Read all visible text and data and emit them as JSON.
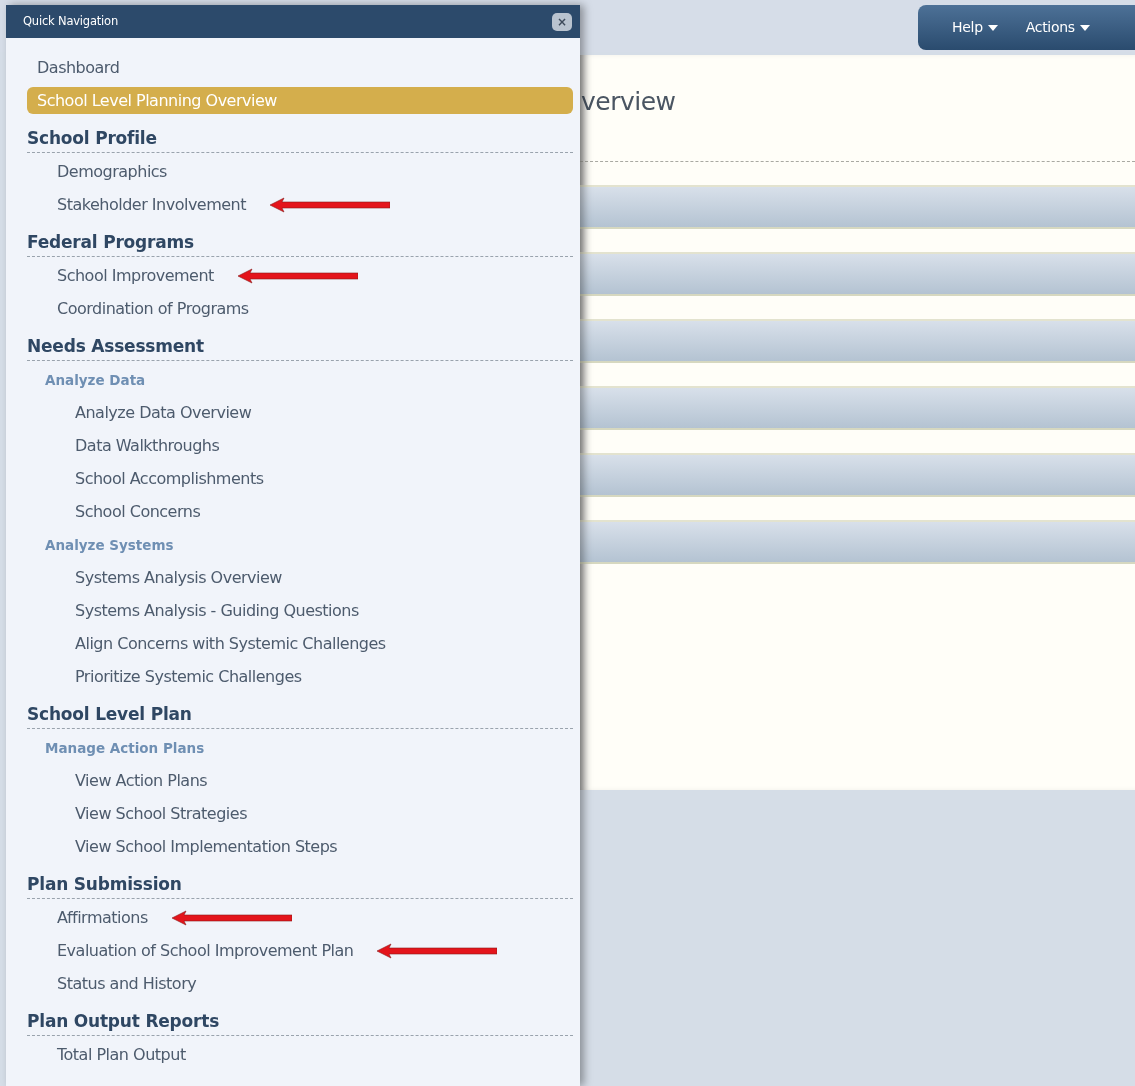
{
  "quick_navigation": {
    "title": "Quick Navigation",
    "close": "×",
    "items": [
      {
        "kind": "link",
        "label": "Dashboard",
        "selected": false,
        "arrow": false
      },
      {
        "kind": "link",
        "label": "School Level Planning Overview",
        "selected": true,
        "arrow": false
      },
      {
        "kind": "section",
        "label": "School Profile",
        "children": [
          {
            "kind": "link",
            "label": "Demographics",
            "selected": false,
            "arrow": false
          },
          {
            "kind": "link",
            "label": "Stakeholder Involvement",
            "selected": false,
            "arrow": true
          }
        ]
      },
      {
        "kind": "section",
        "label": "Federal Programs",
        "children": [
          {
            "kind": "link",
            "label": "School Improvement",
            "selected": false,
            "arrow": true
          },
          {
            "kind": "link",
            "label": "Coordination of Programs",
            "selected": false,
            "arrow": false
          }
        ]
      },
      {
        "kind": "section",
        "label": "Needs Assessment",
        "children": [
          {
            "kind": "group",
            "label": "Analyze Data",
            "children": [
              {
                "kind": "link",
                "label": "Analyze Data Overview",
                "selected": false,
                "arrow": false
              },
              {
                "kind": "link",
                "label": "Data Walkthroughs",
                "selected": false,
                "arrow": false
              },
              {
                "kind": "link",
                "label": "School Accomplishments",
                "selected": false,
                "arrow": false
              },
              {
                "kind": "link",
                "label": "School Concerns",
                "selected": false,
                "arrow": false
              }
            ]
          },
          {
            "kind": "group",
            "label": "Analyze Systems",
            "children": [
              {
                "kind": "link",
                "label": "Systems Analysis Overview",
                "selected": false,
                "arrow": false
              },
              {
                "kind": "link",
                "label": "Systems Analysis - Guiding Questions",
                "selected": false,
                "arrow": false
              },
              {
                "kind": "link",
                "label": "Align Concerns with Systemic Challenges",
                "selected": false,
                "arrow": false
              },
              {
                "kind": "link",
                "label": "Prioritize Systemic Challenges",
                "selected": false,
                "arrow": false
              }
            ]
          }
        ]
      },
      {
        "kind": "section",
        "label": "School Level Plan",
        "children": [
          {
            "kind": "group",
            "label": "Manage Action Plans",
            "children": [
              {
                "kind": "link",
                "label": "View Action Plans",
                "selected": false,
                "arrow": false
              },
              {
                "kind": "link",
                "label": "View School Strategies",
                "selected": false,
                "arrow": false
              },
              {
                "kind": "link",
                "label": "View School Implementation Steps",
                "selected": false,
                "arrow": false
              }
            ]
          }
        ]
      },
      {
        "kind": "section",
        "label": "Plan Submission",
        "children": [
          {
            "kind": "link",
            "label": "Affirmations",
            "selected": false,
            "arrow": true
          },
          {
            "kind": "link",
            "label": "Evaluation of School Improvement Plan",
            "selected": false,
            "arrow": true
          },
          {
            "kind": "link",
            "label": "Status and History",
            "selected": false,
            "arrow": false
          }
        ]
      },
      {
        "kind": "section",
        "label": "Plan Output Reports",
        "children": [
          {
            "kind": "link",
            "label": "Total Plan Output",
            "selected": false,
            "arrow": false
          }
        ]
      }
    ]
  },
  "toolbar": {
    "buttons": [
      "Help",
      "Actions"
    ]
  },
  "main": {
    "title": "verview",
    "panels": [
      {
        "kind": "bar"
      },
      {
        "kind": "bar"
      },
      {
        "kind": "bar"
      },
      {
        "kind": "bar"
      },
      {
        "kind": "bar"
      },
      {
        "kind": "bar"
      }
    ]
  }
}
